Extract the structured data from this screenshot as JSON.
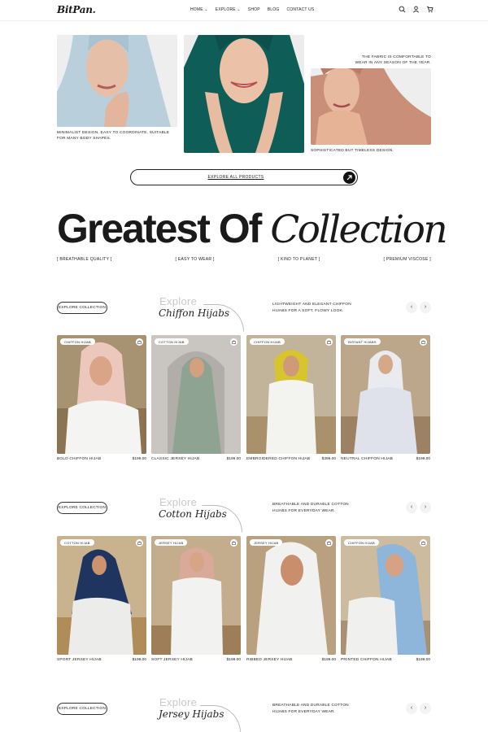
{
  "header": {
    "logo": "BitPan.",
    "nav": [
      "HOME ⌄",
      "EXPLORE ⌄",
      "SHOP",
      "BLOG",
      "CONTACT US"
    ]
  },
  "hero": {
    "caption_left": "MINIMALIST DESIGN, EASY TO COORDINATE, SUITABLE FOR MANY BODY SHAPES.",
    "caption_right_top": "THE FABRIC IS COMFORTABLE TO WEAR IN ANY SEASON OF THE YEAR.",
    "caption_right_bottom": "SOPHISTICATED BUT TIMELESS DESIGN.",
    "explore_all": "EXPLORE ALL PRODUCTS"
  },
  "collection": {
    "title_bold": "Greatest Of ",
    "title_italic": "Collection",
    "tags": [
      "[ BREATHABLE QUALITY ]",
      "[ EASY TO WEAR ]",
      "[ KIND TO PLANET ]",
      "[ PREMIUM VISCOSE ]"
    ]
  },
  "sections": [
    {
      "button": "EXPLORE COLLECTION",
      "explore": "Explore",
      "title": "Chiffon Hijabs",
      "desc": "LIGHTWEIGHT AND ELEGANT CHIFFON HIJABS FOR A SOFT, FLOWY LOOK.",
      "products": [
        {
          "badge": "CHIFFON HIJAB",
          "name": "BOLD CHIFFON HIJAB",
          "price": "$199.00"
        },
        {
          "badge": "COTTON HIJAB",
          "name": "CLASSIC JERSEY HIJAB",
          "price": "$199.00"
        },
        {
          "badge": "CHIFFON HIJAB",
          "name": "EMBROIDERED CHIFFON HIJAB",
          "price": "$399.00"
        },
        {
          "badge": "INSTANT HIJABS",
          "name": "NEUTRAL CHIFFON HIJAB",
          "price": "$199.00"
        }
      ]
    },
    {
      "button": "EXPLORE COLLECTION",
      "explore": "Explore",
      "title": "Cotton Hijabs",
      "desc": "BREATHABLE AND DURABLE COTTON HIJABS FOR EVERYDAY WEAR.",
      "products": [
        {
          "badge": "COTTON HIJAB",
          "name": "SPORT JERSEY HIJAB",
          "price": "$199.00"
        },
        {
          "badge": "JERSEY HIJAB",
          "name": "SOFT JERSEY HIJAB",
          "price": "$199.00"
        },
        {
          "badge": "JERSEY HIJAB",
          "name": "RIBBED JERSEY HIJAB",
          "price": "$199.00"
        },
        {
          "badge": "CHIFFON HIJAB",
          "name": "PRINTED CHIFFON HIJAB",
          "price": "$199.00"
        }
      ]
    },
    {
      "button": "EXPLORE COLLECTION",
      "explore": "Explore",
      "title": "Jersey Hijabs",
      "desc": "BREATHABLE AND DURABLE COTTON HIJABS FOR EVERYDAY WEAR."
    }
  ],
  "icons": {
    "header": [
      "search-icon",
      "user-icon",
      "cart-icon"
    ],
    "pill_arrow": "arrow-up-right-icon",
    "card": "bag-icon",
    "prev": "chevron-left-icon",
    "next": "chevron-right-icon"
  },
  "colors": {
    "hijab_light_blue": "#b9cfdc",
    "hijab_teal": "#0f5d57",
    "hijab_terracotta": "#c98f78",
    "text": "#1a1a1a"
  }
}
